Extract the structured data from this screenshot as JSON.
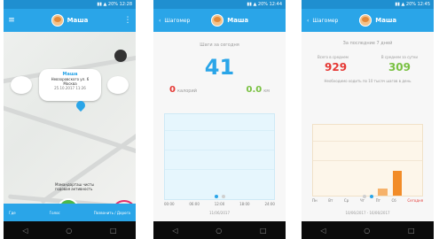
{
  "screens": [
    {
      "app_title": "Маша",
      "map": {
        "bubble_name": "Маша",
        "bubble_address_line1": "Невзоровского ул. 6",
        "bubble_address_line2": "Москва",
        "bubble_time": "25.10.2017 11:26",
        "info_text_line1": "Мамандарташ чисты",
        "info_text_line2": "годовая активность"
      },
      "bottom_bar": {
        "left_label": "Где",
        "mid_label": "Голос",
        "right_label": "Позвонить / Дорога"
      }
    },
    {
      "back_label": "Шагомер",
      "app_title": "Маша",
      "steps_title": "Шаги за сегодня",
      "steps_value": "41",
      "calories_value": "0",
      "calories_unit": "калорий",
      "distance_value": "0.0",
      "distance_unit": "км",
      "x_ticks": [
        "00:00",
        "06:00",
        "12:00",
        "18:00",
        "24:00"
      ],
      "date_label": "11/06/2017"
    },
    {
      "back_label": "Шагомер",
      "app_title": "Маша",
      "period_title": "За последние 7 дней",
      "total_label": "Всего в среднем",
      "avg_label": "В среднем за сутки",
      "total_value": "929",
      "avg_value": "309",
      "note": "Необходимо ходить по 10 тысяч шагов в день",
      "week_bars_values": [
        0,
        0,
        0,
        0,
        240,
        820,
        0
      ],
      "week_axis_labels": [
        "Пн",
        "Вт",
        "Ср",
        "Чт",
        "Пт",
        "Сб",
        "Сегодня"
      ],
      "date_label": "10/06/2017 - 16/06/2017"
    }
  ]
}
